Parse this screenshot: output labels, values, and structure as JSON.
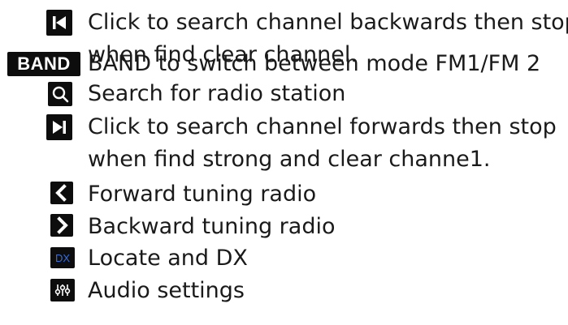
{
  "icons": {
    "skip_back": "skip-back-icon",
    "band": "BAND",
    "search": "search-icon",
    "skip_forward": "skip-forward-icon",
    "chevron_left": "chevron-left-icon",
    "chevron_right": "chevron-right-icon",
    "dx": "DX",
    "audio": "equalizer-icon"
  },
  "colors": {
    "icon_background": "#0d0d0d",
    "icon_foreground": "#ffffff",
    "dx_foreground": "#3a6fd8",
    "text": "#1a1a1a"
  },
  "items": [
    {
      "line1": "Click to search channel backwards then stop",
      "line2": "when find clear channel."
    },
    {
      "line1": "BAND to switch between mode FM1/FM 2"
    },
    {
      "line1": "Search for radio station"
    },
    {
      "line1": "Click to search channel forwards then stop",
      "line2": "when find strong and clear channe1."
    },
    {
      "line1": "Forward tuning radio"
    },
    {
      "line1": "Backward tuning radio"
    },
    {
      "line1": "Locate and DX"
    },
    {
      "line1": "Audio settings"
    }
  ]
}
